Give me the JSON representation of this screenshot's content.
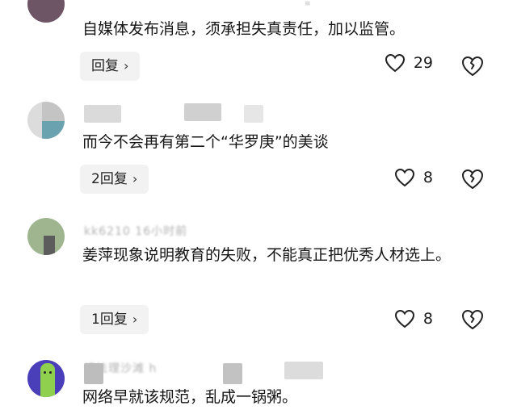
{
  "comments": [
    {
      "text": "自媒体发布消息，须承担失真责任，加以监管。",
      "meta": "",
      "reply_label": "回复",
      "likes": "29"
    },
    {
      "text": "而今不会再有第二个“华罗庚”的美谈",
      "meta": "",
      "reply_label": "2回复",
      "likes": "8"
    },
    {
      "text": "姜萍现象说明教育的失败，不能真正把优秀人材选上。",
      "meta": "kk6210 16小时前",
      "reply_label": "1回复",
      "likes": "8"
    },
    {
      "text": "网络早就该规范，乱成一锅粥。",
      "meta": "请法理沙滩 h",
      "reply_label": "",
      "likes": ""
    }
  ],
  "icons": {
    "like": "heart-outline-icon",
    "dislike": "broken-heart-icon",
    "chevron": "chevron-right-icon"
  },
  "colors": {
    "background": "#ffffff",
    "reply_button_bg": "#f2f2f2",
    "text": "#161616"
  }
}
